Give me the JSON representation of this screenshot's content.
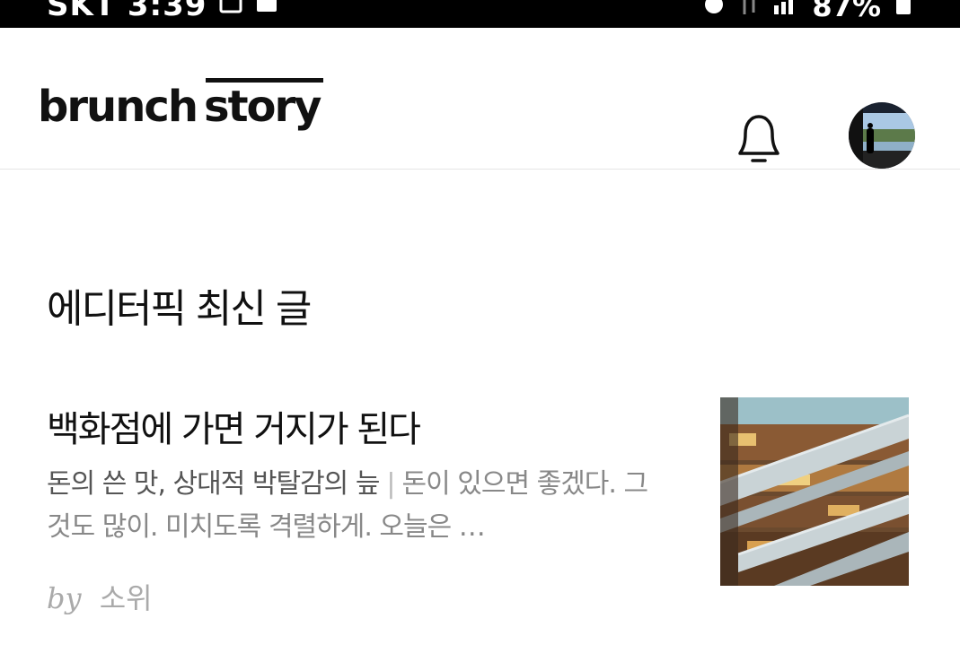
{
  "status_bar": {
    "time": "SKT 3:39",
    "battery": "87%"
  },
  "header": {
    "logo_part1": "brunch",
    "logo_part2": "story"
  },
  "section": {
    "title": "에디터픽 최신 글"
  },
  "article": {
    "title": "백화점에 가면 거지가 된다",
    "subtitle": "돈의 쓴 맛, 상대적 박탈감의 늪",
    "separator": "|",
    "excerpt": "돈이 있으면 좋겠다. 그것도 많이. 미치도록 격렬하게. 오늘은 …",
    "by": "by",
    "author": "소위"
  },
  "icons": {
    "notification": "bell-icon",
    "profile": "avatar"
  },
  "colors": {
    "text_primary": "#111111",
    "text_secondary": "#555555",
    "text_muted": "#aaaaaa",
    "divider": "#e6e6e6"
  }
}
